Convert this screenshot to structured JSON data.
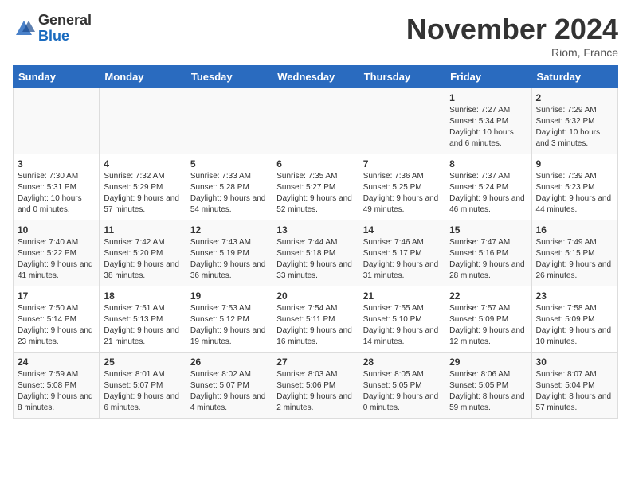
{
  "header": {
    "logo_general": "General",
    "logo_blue": "Blue",
    "month_title": "November 2024",
    "location": "Riom, France"
  },
  "weekdays": [
    "Sunday",
    "Monday",
    "Tuesday",
    "Wednesday",
    "Thursday",
    "Friday",
    "Saturday"
  ],
  "weeks": [
    [
      {
        "day": "",
        "info": ""
      },
      {
        "day": "",
        "info": ""
      },
      {
        "day": "",
        "info": ""
      },
      {
        "day": "",
        "info": ""
      },
      {
        "day": "",
        "info": ""
      },
      {
        "day": "1",
        "info": "Sunrise: 7:27 AM\nSunset: 5:34 PM\nDaylight: 10 hours\nand 6 minutes."
      },
      {
        "day": "2",
        "info": "Sunrise: 7:29 AM\nSunset: 5:32 PM\nDaylight: 10 hours\nand 3 minutes."
      }
    ],
    [
      {
        "day": "3",
        "info": "Sunrise: 7:30 AM\nSunset: 5:31 PM\nDaylight: 10 hours\nand 0 minutes."
      },
      {
        "day": "4",
        "info": "Sunrise: 7:32 AM\nSunset: 5:29 PM\nDaylight: 9 hours\nand 57 minutes."
      },
      {
        "day": "5",
        "info": "Sunrise: 7:33 AM\nSunset: 5:28 PM\nDaylight: 9 hours\nand 54 minutes."
      },
      {
        "day": "6",
        "info": "Sunrise: 7:35 AM\nSunset: 5:27 PM\nDaylight: 9 hours\nand 52 minutes."
      },
      {
        "day": "7",
        "info": "Sunrise: 7:36 AM\nSunset: 5:25 PM\nDaylight: 9 hours\nand 49 minutes."
      },
      {
        "day": "8",
        "info": "Sunrise: 7:37 AM\nSunset: 5:24 PM\nDaylight: 9 hours\nand 46 minutes."
      },
      {
        "day": "9",
        "info": "Sunrise: 7:39 AM\nSunset: 5:23 PM\nDaylight: 9 hours\nand 44 minutes."
      }
    ],
    [
      {
        "day": "10",
        "info": "Sunrise: 7:40 AM\nSunset: 5:22 PM\nDaylight: 9 hours\nand 41 minutes."
      },
      {
        "day": "11",
        "info": "Sunrise: 7:42 AM\nSunset: 5:20 PM\nDaylight: 9 hours\nand 38 minutes."
      },
      {
        "day": "12",
        "info": "Sunrise: 7:43 AM\nSunset: 5:19 PM\nDaylight: 9 hours\nand 36 minutes."
      },
      {
        "day": "13",
        "info": "Sunrise: 7:44 AM\nSunset: 5:18 PM\nDaylight: 9 hours\nand 33 minutes."
      },
      {
        "day": "14",
        "info": "Sunrise: 7:46 AM\nSunset: 5:17 PM\nDaylight: 9 hours\nand 31 minutes."
      },
      {
        "day": "15",
        "info": "Sunrise: 7:47 AM\nSunset: 5:16 PM\nDaylight: 9 hours\nand 28 minutes."
      },
      {
        "day": "16",
        "info": "Sunrise: 7:49 AM\nSunset: 5:15 PM\nDaylight: 9 hours\nand 26 minutes."
      }
    ],
    [
      {
        "day": "17",
        "info": "Sunrise: 7:50 AM\nSunset: 5:14 PM\nDaylight: 9 hours\nand 23 minutes."
      },
      {
        "day": "18",
        "info": "Sunrise: 7:51 AM\nSunset: 5:13 PM\nDaylight: 9 hours\nand 21 minutes."
      },
      {
        "day": "19",
        "info": "Sunrise: 7:53 AM\nSunset: 5:12 PM\nDaylight: 9 hours\nand 19 minutes."
      },
      {
        "day": "20",
        "info": "Sunrise: 7:54 AM\nSunset: 5:11 PM\nDaylight: 9 hours\nand 16 minutes."
      },
      {
        "day": "21",
        "info": "Sunrise: 7:55 AM\nSunset: 5:10 PM\nDaylight: 9 hours\nand 14 minutes."
      },
      {
        "day": "22",
        "info": "Sunrise: 7:57 AM\nSunset: 5:09 PM\nDaylight: 9 hours\nand 12 minutes."
      },
      {
        "day": "23",
        "info": "Sunrise: 7:58 AM\nSunset: 5:09 PM\nDaylight: 9 hours\nand 10 minutes."
      }
    ],
    [
      {
        "day": "24",
        "info": "Sunrise: 7:59 AM\nSunset: 5:08 PM\nDaylight: 9 hours\nand 8 minutes."
      },
      {
        "day": "25",
        "info": "Sunrise: 8:01 AM\nSunset: 5:07 PM\nDaylight: 9 hours\nand 6 minutes."
      },
      {
        "day": "26",
        "info": "Sunrise: 8:02 AM\nSunset: 5:07 PM\nDaylight: 9 hours\nand 4 minutes."
      },
      {
        "day": "27",
        "info": "Sunrise: 8:03 AM\nSunset: 5:06 PM\nDaylight: 9 hours\nand 2 minutes."
      },
      {
        "day": "28",
        "info": "Sunrise: 8:05 AM\nSunset: 5:05 PM\nDaylight: 9 hours\nand 0 minutes."
      },
      {
        "day": "29",
        "info": "Sunrise: 8:06 AM\nSunset: 5:05 PM\nDaylight: 8 hours\nand 59 minutes."
      },
      {
        "day": "30",
        "info": "Sunrise: 8:07 AM\nSunset: 5:04 PM\nDaylight: 8 hours\nand 57 minutes."
      }
    ]
  ]
}
